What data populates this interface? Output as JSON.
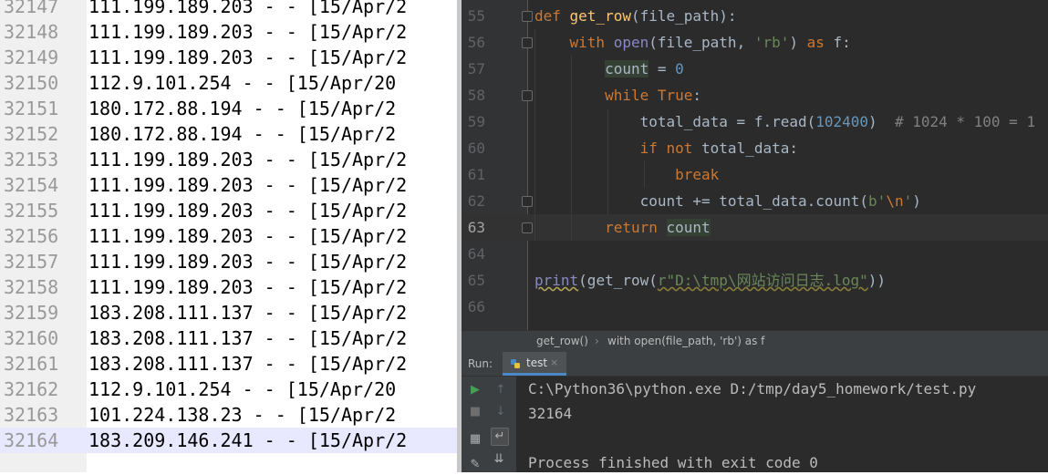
{
  "log_viewer": {
    "rows": [
      {
        "line": "32147",
        "text": "111.199.189.203 - - [15/Apr/2"
      },
      {
        "line": "32148",
        "text": "111.199.189.203 - - [15/Apr/2"
      },
      {
        "line": "32149",
        "text": "111.199.189.203 - - [15/Apr/2"
      },
      {
        "line": "32150",
        "text": "112.9.101.254 - - [15/Apr/20"
      },
      {
        "line": "32151",
        "text": "180.172.88.194 - - [15/Apr/2"
      },
      {
        "line": "32152",
        "text": "180.172.88.194 - - [15/Apr/2"
      },
      {
        "line": "32153",
        "text": "111.199.189.203 - - [15/Apr/2"
      },
      {
        "line": "32154",
        "text": "111.199.189.203 - - [15/Apr/2"
      },
      {
        "line": "32155",
        "text": "111.199.189.203 - - [15/Apr/2"
      },
      {
        "line": "32156",
        "text": "111.199.189.203 - - [15/Apr/2"
      },
      {
        "line": "32157",
        "text": "111.199.189.203 - - [15/Apr/2"
      },
      {
        "line": "32158",
        "text": "111.199.189.203 - - [15/Apr/2"
      },
      {
        "line": "32159",
        "text": "183.208.111.137 - - [15/Apr/2"
      },
      {
        "line": "32160",
        "text": "183.208.111.137 - - [15/Apr/2"
      },
      {
        "line": "32161",
        "text": "183.208.111.137 - - [15/Apr/2"
      },
      {
        "line": "32162",
        "text": "112.9.101.254 - - [15/Apr/20"
      },
      {
        "line": "32163",
        "text": "101.224.138.23 - - [15/Apr/2"
      },
      {
        "line": "32164",
        "text": "183.209.146.241 - - [15/Apr/2"
      }
    ]
  },
  "editor": {
    "lines": [
      {
        "num": "55",
        "tokens": [
          [
            "kw",
            "def "
          ],
          [
            "fn",
            "get_row"
          ],
          [
            "p",
            "(file_path):"
          ]
        ]
      },
      {
        "num": "56",
        "tokens": [
          [
            "p",
            "    "
          ],
          [
            "kw",
            "with "
          ],
          [
            "bi",
            "open"
          ],
          [
            "p",
            "(file_path, "
          ],
          [
            "str",
            "'rb'"
          ],
          [
            "p",
            ") "
          ],
          [
            "kw",
            "as "
          ],
          [
            "p",
            "f:"
          ]
        ]
      },
      {
        "num": "57",
        "tokens": [
          [
            "p",
            "        "
          ],
          [
            "var",
            "count"
          ],
          [
            "p",
            " = "
          ],
          [
            "num",
            "0"
          ]
        ]
      },
      {
        "num": "58",
        "tokens": [
          [
            "p",
            "        "
          ],
          [
            "kw",
            "while True"
          ],
          [
            "p",
            ":"
          ]
        ]
      },
      {
        "num": "59",
        "tokens": [
          [
            "p",
            "            total_data = f.read("
          ],
          [
            "num",
            "102400"
          ],
          [
            "p",
            ")  "
          ],
          [
            "cmt",
            "# 1024 * 100 = 1"
          ]
        ]
      },
      {
        "num": "60",
        "tokens": [
          [
            "p",
            "            "
          ],
          [
            "kw",
            "if not "
          ],
          [
            "p",
            "total_data:"
          ]
        ]
      },
      {
        "num": "61",
        "tokens": [
          [
            "p",
            "                "
          ],
          [
            "kw",
            "break"
          ]
        ]
      },
      {
        "num": "62",
        "tokens": [
          [
            "p",
            "            count += total_data.count("
          ],
          [
            "str",
            "b'"
          ],
          [
            "esc",
            "\\n"
          ],
          [
            "str",
            "'"
          ],
          [
            "p",
            ")"
          ]
        ]
      },
      {
        "num": "63",
        "tokens": [
          [
            "p",
            "        "
          ],
          [
            "kw",
            "return "
          ],
          [
            "var",
            "count"
          ]
        ]
      },
      {
        "num": "64",
        "tokens": []
      },
      {
        "num": "65",
        "tokens": [
          [
            "print",
            "print"
          ],
          [
            "p",
            "(get_row("
          ],
          [
            "str",
            "r\"D:\\tmp\\网站访问日志.log\""
          ],
          [
            "p",
            "))"
          ]
        ]
      },
      {
        "num": "66",
        "tokens": []
      }
    ]
  },
  "breadcrumb": {
    "item1": "get_row()",
    "sep": "›",
    "item2": "with open(file_path, 'rb') as f"
  },
  "run_panel": {
    "label": "Run:",
    "tab_label": "test",
    "tab_close": "×",
    "console": [
      "C:\\Python36\\python.exe D:/tmp/day5_homework/test.py",
      "32164",
      "",
      "Process finished with exit code 0"
    ]
  },
  "colors": {
    "editor_bg": "#2b2b2b",
    "keyword": "#cc7832",
    "function": "#ffc66d",
    "number": "#6897bb",
    "string": "#6a8759",
    "comment": "#808080",
    "run_green": "#499c54"
  }
}
